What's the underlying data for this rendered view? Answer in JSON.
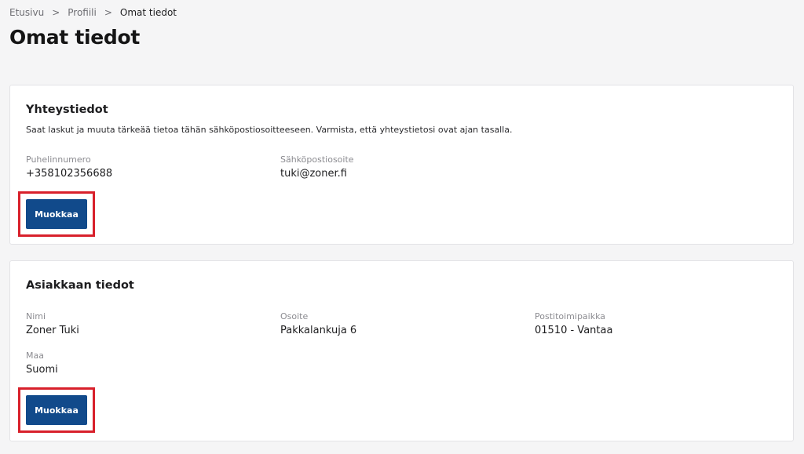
{
  "breadcrumb": {
    "items": [
      "Etusivu",
      "Profiili",
      "Omat tiedot"
    ],
    "separator": ">"
  },
  "page": {
    "title": "Omat tiedot"
  },
  "contact_card": {
    "title": "Yhteystiedot",
    "description": "Saat laskut ja muuta tärkeää tietoa tähän sähköpostiosoitteeseen. Varmista, että yhteystietosi ovat ajan tasalla.",
    "fields": [
      {
        "label": "Puhelinnumero",
        "value": "+358102356688"
      },
      {
        "label": "Sähköpostiosoite",
        "value": "tuki@zoner.fi"
      }
    ],
    "edit_button": "Muokkaa"
  },
  "customer_card": {
    "title": "Asiakkaan tiedot",
    "fields": [
      {
        "label": "Nimi",
        "value": "Zoner Tuki"
      },
      {
        "label": "Osoite",
        "value": "Pakkalankuja 6"
      },
      {
        "label": "Postitoimipaikka",
        "value": "01510 - Vantaa"
      },
      {
        "label": "Maa",
        "value": "Suomi"
      }
    ],
    "edit_button": "Muokkaa"
  },
  "colors": {
    "primary_button": "#114a8b",
    "highlight_border": "#d8202b",
    "page_background": "#f5f5f6"
  }
}
